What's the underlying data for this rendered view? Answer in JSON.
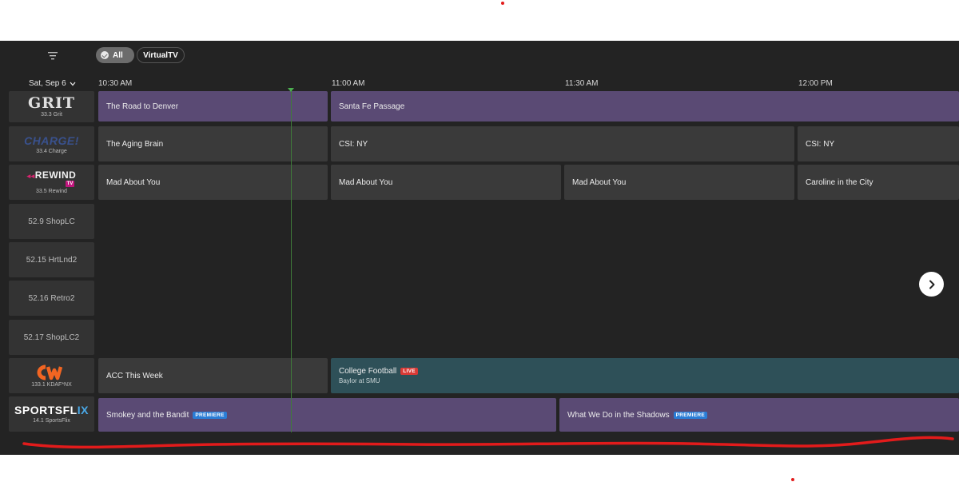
{
  "filters": {
    "all_label": "All",
    "virtualtv_label": "VirtualTV"
  },
  "date": {
    "label": "Sat, Sep 6"
  },
  "times": [
    "10:30 AM",
    "11:00 AM",
    "11:30 AM",
    "12:00 PM"
  ],
  "channels": [
    {
      "logo": "GRIT",
      "number": "33.3 Grit"
    },
    {
      "logo": "CHARGE!",
      "number": "33.4 Charge"
    },
    {
      "logo_main": "REWIND",
      "logo_sub": "TV",
      "number": "33.5 Rewind"
    },
    {
      "number": "52.9 ShopLC"
    },
    {
      "number": "52.15 HrtLnd2"
    },
    {
      "number": "52.16 Retro2"
    },
    {
      "number": "52.17 ShopLC2"
    },
    {
      "number": "133.1 KDAF*NX"
    },
    {
      "logo_main": "SPORTSFL",
      "logo_accent": "IX",
      "number": "14.1 SportsFlix"
    }
  ],
  "programs": {
    "grit": [
      "The Road to Denver",
      "Santa Fe Passage"
    ],
    "charge": [
      "The Aging Brain",
      "CSI: NY",
      "CSI: NY"
    ],
    "rewind": [
      "Mad About You",
      "Mad About You",
      "Mad About You",
      "Caroline in the City"
    ],
    "cw": {
      "first": "ACC This Week",
      "second_title": "College Football",
      "second_badge": "LIVE",
      "second_sub": "Baylor at SMU"
    },
    "sportsflix": {
      "first": "Smokey and the Bandit",
      "first_badge": "PREMIERE",
      "second": "What We Do in the Shadows",
      "second_badge": "PREMIERE"
    }
  },
  "colors": {
    "guide_bg": "#232323",
    "program_purple": "#5a4a74",
    "program_gray": "#3a3a3a",
    "program_teal": "#2e5058",
    "live_badge": "#d93a36",
    "premiere_badge": "#2a7dd6",
    "now_line": "#4caf50",
    "annotation": "#e21b1b"
  },
  "icons": {
    "menu": "filter-sort-icon",
    "date_dropdown": "chevron-down-icon",
    "next": "chevron-right-icon",
    "filter_check": "check-circle-icon"
  }
}
